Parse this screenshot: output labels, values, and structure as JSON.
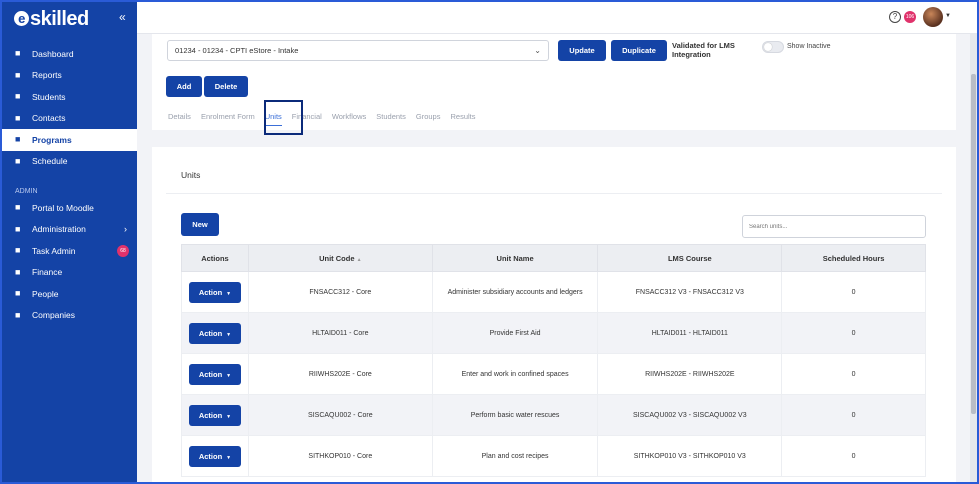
{
  "app": {
    "logo_text": "skilled",
    "logo_letter": "e"
  },
  "colors": {
    "brand": "#1443a6",
    "badge": "#e0326b",
    "tab_active": "#3b6fd8"
  },
  "sidebar": {
    "items": [
      {
        "label": "Dashboard",
        "icon": "chart-line-icon"
      },
      {
        "label": "Reports",
        "icon": "report-icon"
      },
      {
        "label": "Students",
        "icon": "users-icon"
      },
      {
        "label": "Contacts",
        "icon": "contact-card-icon"
      },
      {
        "label": "Programs",
        "icon": "window-icon",
        "active": true
      },
      {
        "label": "Schedule",
        "icon": "calendar-icon"
      }
    ],
    "admin_label": "ADMIN",
    "admin_items": [
      {
        "label": "Portal to Moodle",
        "icon": "portal-icon"
      },
      {
        "label": "Administration",
        "icon": "briefcase-icon",
        "chevron": "›"
      },
      {
        "label": "Task Admin",
        "icon": "list-icon",
        "badge": "68"
      },
      {
        "label": "Finance",
        "icon": "coins-icon"
      },
      {
        "label": "People",
        "icon": "people-icon"
      },
      {
        "label": "Companies",
        "icon": "building-icon"
      }
    ]
  },
  "topbar": {
    "help": "?",
    "notification_count": "106"
  },
  "upper": {
    "intake_value": "01234 - 01234 - CPTI eStore - Intake",
    "update_label": "Update",
    "duplicate_label": "Duplicate",
    "validated_label": "Validated for LMS Integration",
    "show_inactive_label": "Show Inactive",
    "add_label": "Add",
    "delete_label": "Delete"
  },
  "tabs": [
    "Details",
    "Enrolment Form",
    "Units",
    "Financial",
    "Workflows",
    "Students",
    "Groups",
    "Results"
  ],
  "active_tab": "Units",
  "units": {
    "title": "Units",
    "new_label": "New",
    "search_placeholder": "Search units...",
    "columns": [
      "Actions",
      "Unit Code",
      "Unit Name",
      "LMS Course",
      "Scheduled Hours"
    ],
    "sort_indicator": "▲",
    "action_label": "Action",
    "rows": [
      {
        "code": "FNSACC312 - Core",
        "name": "Administer subsidiary accounts and ledgers",
        "lms": "FNSACC312 V3 - FNSACC312 V3",
        "hours": "0"
      },
      {
        "code": "HLTAID011 - Core",
        "name": "Provide First Aid",
        "lms": "HLTAID011 - HLTAID011",
        "hours": "0"
      },
      {
        "code": "RIIWHS202E - Core",
        "name": "Enter and work in confined spaces",
        "lms": "RIIWHS202E - RIIWHS202E",
        "hours": "0"
      },
      {
        "code": "SISCAQU002 - Core",
        "name": "Perform basic water rescues",
        "lms": "SISCAQU002 V3 - SISCAQU002 V3",
        "hours": "0"
      },
      {
        "code": "SITHKOP010 - Core",
        "name": "Plan and cost recipes",
        "lms": "SITHKOP010 V3 - SITHKOP010 V3",
        "hours": "0"
      }
    ]
  }
}
